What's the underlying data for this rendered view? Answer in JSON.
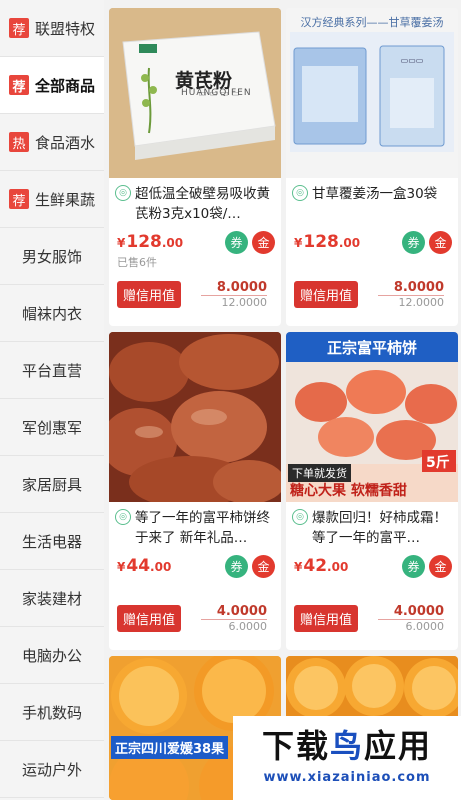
{
  "sidebar": {
    "items": [
      {
        "tag": "荐",
        "label": "联盟特权",
        "active": false
      },
      {
        "tag": "荐",
        "label": "全部商品",
        "active": true
      },
      {
        "tag": "热",
        "label": "食品酒水",
        "active": false
      },
      {
        "tag": "荐",
        "label": "生鲜果蔬",
        "active": false
      },
      {
        "tag": "",
        "label": "男女服饰",
        "active": false
      },
      {
        "tag": "",
        "label": "帽袜内衣",
        "active": false
      },
      {
        "tag": "",
        "label": "平台直营",
        "active": false
      },
      {
        "tag": "",
        "label": "军创惠军",
        "active": false
      },
      {
        "tag": "",
        "label": "家居厨具",
        "active": false
      },
      {
        "tag": "",
        "label": "生活电器",
        "active": false
      },
      {
        "tag": "",
        "label": "家装建材",
        "active": false
      },
      {
        "tag": "",
        "label": "电脑办公",
        "active": false
      },
      {
        "tag": "",
        "label": "手机数码",
        "active": false
      },
      {
        "tag": "",
        "label": "运动户外",
        "active": false
      }
    ]
  },
  "products": [
    {
      "image_label": "黄芪粉",
      "image_sublabel": "HUANGQIFEN",
      "title": "超低温全破壁易吸收黄芪粉3克x10袋/…",
      "price_int": "128",
      "price_dec": ".00",
      "sold": "已售6件",
      "button": "赠信用值",
      "credit_main": "8.0000",
      "credit_orig": "12.0000"
    },
    {
      "image_label": "汉方经典系列——甘草覆姜汤",
      "image_sublabel": "",
      "title": "甘草覆姜汤一盒30袋",
      "price_int": "128",
      "price_dec": ".00",
      "sold": "",
      "button": "赠信用值",
      "credit_main": "8.0000",
      "credit_orig": "12.0000"
    },
    {
      "image_label": "",
      "image_sublabel": "",
      "title": "等了一年的富平柿饼终于来了 新年礼品…",
      "price_int": "44",
      "price_dec": ".00",
      "sold": "",
      "button": "赠信用值",
      "credit_main": "4.0000",
      "credit_orig": "6.0000"
    },
    {
      "image_label": "正宗富平柿饼",
      "image_sublabel": "糖心大果 软糯香甜",
      "image_tag1": "下单就发货",
      "image_tag2": "5斤",
      "title": "爆款回归！好柿成霜！ 等了一年的富平…",
      "price_int": "42",
      "price_dec": ".00",
      "sold": "",
      "button": "赠信用值",
      "credit_main": "4.0000",
      "credit_orig": "6.0000"
    },
    {
      "image_label": "正宗四川爱媛38果",
      "title": ""
    },
    {
      "image_label": "",
      "title": ""
    }
  ],
  "badges": {
    "coupon": "券",
    "gold": "金"
  },
  "currency": "¥",
  "shop_icon": "store-icon",
  "watermark": {
    "text_a": "下载",
    "text_b": "鸟",
    "text_c": "应用",
    "url": "www.xiazainiao.com"
  },
  "colors": {
    "accent_red": "#e23a2e",
    "green": "#36b37e"
  }
}
